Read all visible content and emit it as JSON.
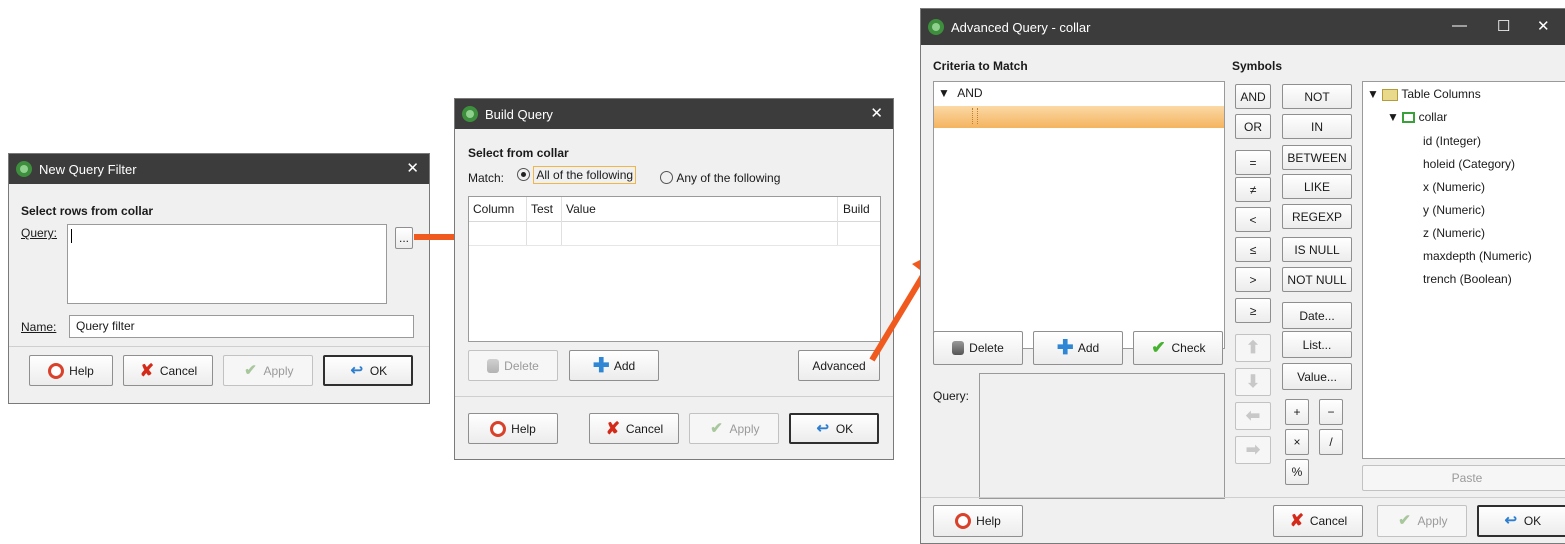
{
  "dialog1": {
    "title": "New Query Filter",
    "heading": "Select rows from collar",
    "query_label": "Query:",
    "query_value": "",
    "browse_label": "...",
    "name_label": "Name:",
    "name_value": "Query filter",
    "buttons": {
      "help": "Help",
      "cancel": "Cancel",
      "apply": "Apply",
      "ok": "OK"
    }
  },
  "dialog2": {
    "title": "Build Query",
    "heading": "Select from collar",
    "match_label": "Match:",
    "match_all": "All of the following",
    "match_any": "Any of the following",
    "match_selected": "all",
    "columns": [
      "Column",
      "Test",
      "Value",
      "Build"
    ],
    "delete_label": "Delete",
    "add_label": "Add",
    "advanced_label": "Advanced",
    "buttons": {
      "help": "Help",
      "cancel": "Cancel",
      "apply": "Apply",
      "ok": "OK"
    }
  },
  "dialog3": {
    "title": "Advanced Query - collar",
    "criteria_heading": "Criteria to Match",
    "criteria_root": "AND",
    "symbols_heading": "Symbols",
    "symbols_col1": [
      "AND",
      "OR",
      "=",
      "≠",
      "<",
      "≤",
      ">",
      "≥"
    ],
    "symbols_col2": [
      "NOT",
      "IN",
      "BETWEEN",
      "LIKE",
      "REGEXP",
      "IS NULL",
      "NOT NULL",
      "Date...",
      "List...",
      "Value..."
    ],
    "operators": [
      "+",
      "−",
      "×",
      "/",
      "%"
    ],
    "tree": {
      "root": "Table Columns",
      "table": "collar",
      "columns": [
        "id  (Integer)",
        "holeid  (Category)",
        "x  (Numeric)",
        "y  (Numeric)",
        "z  (Numeric)",
        "maxdepth  (Numeric)",
        "trench  (Boolean)"
      ]
    },
    "delete_label": "Delete",
    "add_label": "Add",
    "check_label": "Check",
    "query_label": "Query:",
    "paste_label": "Paste",
    "buttons": {
      "help": "Help",
      "cancel": "Cancel",
      "apply": "Apply",
      "ok": "OK"
    }
  },
  "colors": {
    "titlebar": "#3c3c3c",
    "arrow": "#f05a1e",
    "selection": "#f7c27a",
    "dialog_bg": "#f0f0f0"
  }
}
